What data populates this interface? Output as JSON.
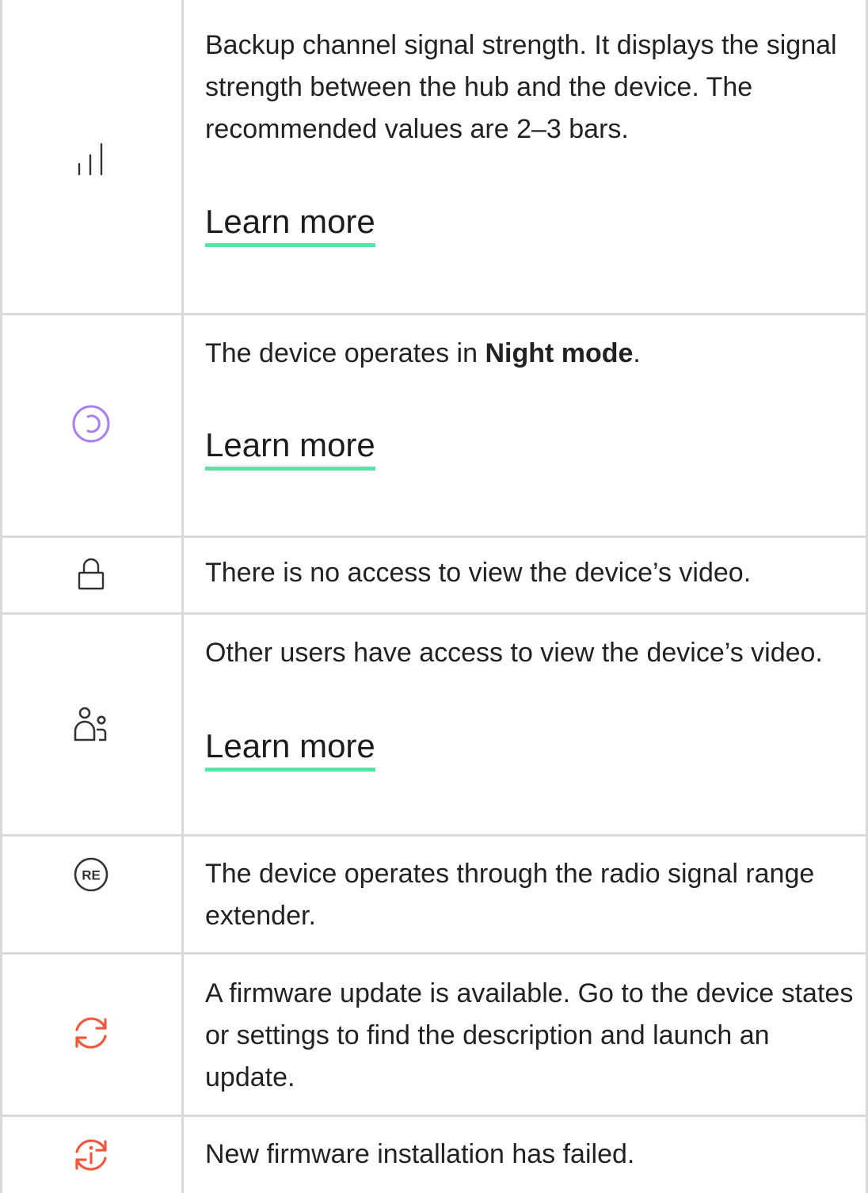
{
  "rows": [
    {
      "icon": "signal-bars-icon",
      "text": "Backup channel signal strength. It displays the signal strength between the hub and the device. The recommended values are 2–3 bars.",
      "link_label": "Learn more"
    },
    {
      "icon": "night-mode-icon",
      "text_before": "The device operates in ",
      "text_bold": "Night mode",
      "text_after": ".",
      "link_label": "Learn more"
    },
    {
      "icon": "lock-icon",
      "text": "There is no access to view the device’s video."
    },
    {
      "icon": "shared-users-icon",
      "text": "Other users have access to view the device’s video.",
      "link_label": "Learn more"
    },
    {
      "icon": "range-extender-icon",
      "icon_label": "RE",
      "text": "The device operates through the radio signal range extender."
    },
    {
      "icon": "firmware-update-icon",
      "text": "A firmware update is available. Go to the device states or settings to find the description and launch an update."
    },
    {
      "icon": "firmware-failed-icon",
      "text": "New firmware installation has failed."
    }
  ],
  "colors": {
    "border": "#d9d9d9",
    "text": "#222222",
    "link_underline": "#5ee0a8",
    "night_mode": "#a87ff0",
    "firmware": "#ef5a3e"
  }
}
